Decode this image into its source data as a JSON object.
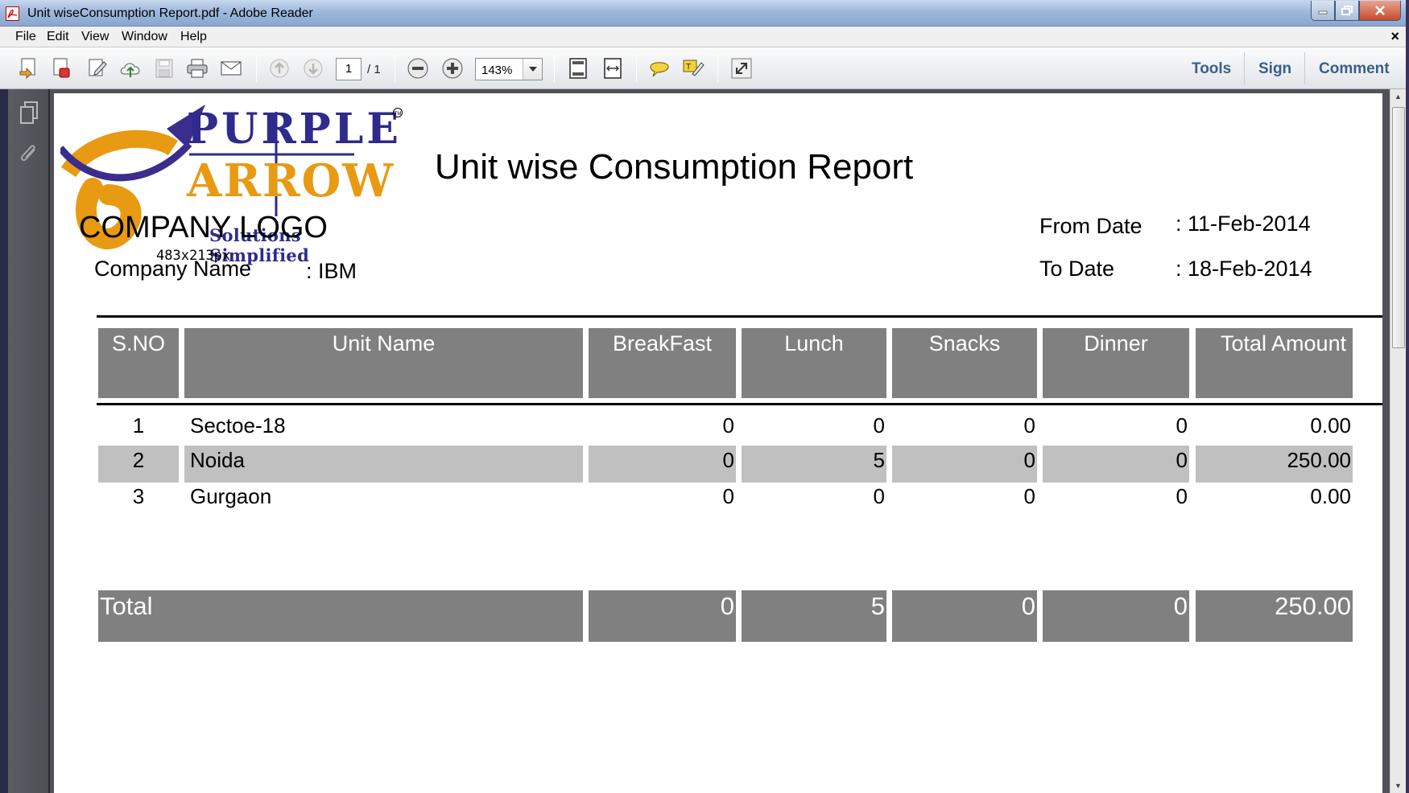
{
  "window": {
    "title": "Unit wiseConsumption Report.pdf - Adobe Reader"
  },
  "menu": {
    "items": [
      "File",
      "Edit",
      "View",
      "Window",
      "Help"
    ],
    "close_doc": "×"
  },
  "toolbar": {
    "current_page": "1",
    "page_total": "/ 1",
    "zoom": "143%",
    "tools_label": "Tools",
    "sign_label": "Sign",
    "comment_label": "Comment"
  },
  "report": {
    "logo": {
      "word1": "PURPLE",
      "word2": "ARROW",
      "tagline": "Solutions Simplified",
      "caption": "COMPANY LOGO",
      "dims": "483x213px",
      "tm": "TM"
    },
    "title": "Unit wise Consumption Report",
    "from_date_label": "From Date",
    "from_date_value": ":  11-Feb-2014",
    "to_date_label": "To Date",
    "to_date_value": ":  18-Feb-2014",
    "company_label": "Company Name",
    "company_value": ":  IBM",
    "headers": [
      "S.NO",
      "Unit Name",
      "BreakFast",
      "Lunch",
      "Snacks",
      "Dinner",
      "Total Amount"
    ],
    "rows": [
      {
        "sno": "1",
        "unit": "Sectoe-18",
        "breakfast": "0",
        "lunch": "0",
        "snacks": "0",
        "dinner": "0",
        "total": "0.00"
      },
      {
        "sno": "2",
        "unit": "Noida",
        "breakfast": "0",
        "lunch": "5",
        "snacks": "0",
        "dinner": "0",
        "total": "250.00"
      },
      {
        "sno": "3",
        "unit": "Gurgaon",
        "breakfast": "0",
        "lunch": "0",
        "snacks": "0",
        "dinner": "0",
        "total": "0.00"
      }
    ],
    "totals": {
      "label": "Total",
      "breakfast": "0",
      "lunch": "5",
      "snacks": "0",
      "dinner": "0",
      "total": "250.00"
    }
  }
}
